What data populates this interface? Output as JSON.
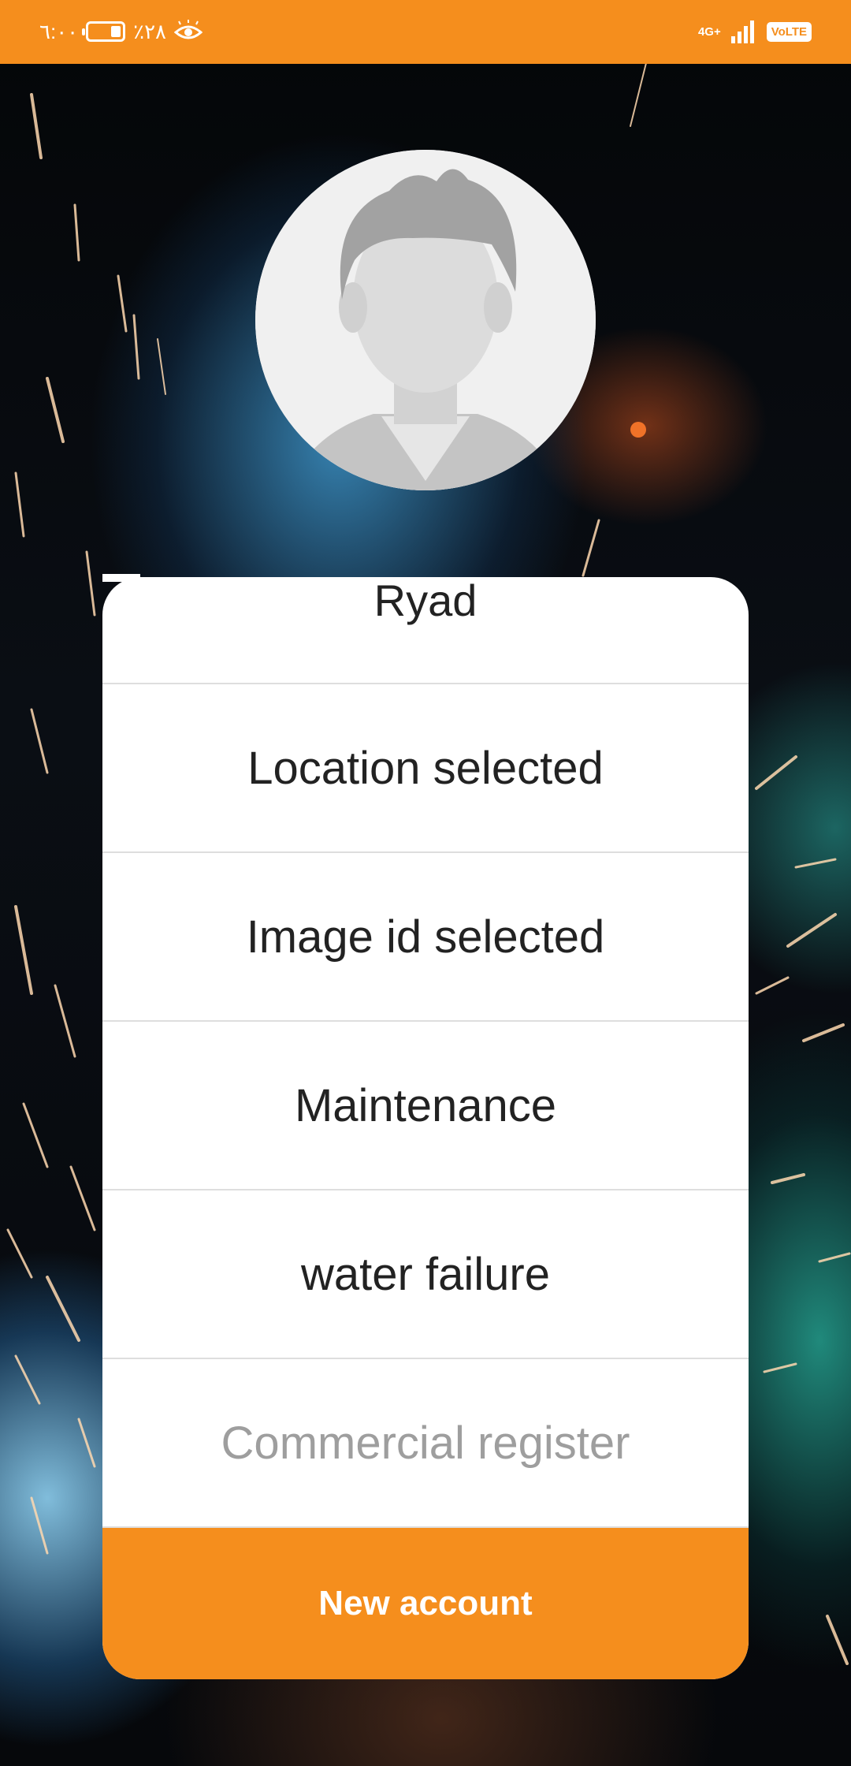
{
  "status_bar": {
    "time": "٦:٠٠",
    "battery_percent": "٪٢٨",
    "network_type": "4G+",
    "volte_label": "VoLTE",
    "background_color": "#f58e1d"
  },
  "profile": {
    "avatar_icon": "default-male-avatar-icon",
    "name": "Ryad"
  },
  "form": {
    "fields": [
      {
        "value": "Location selected",
        "is_placeholder": false
      },
      {
        "value": "Image id selected",
        "is_placeholder": false
      },
      {
        "value": "Maintenance",
        "is_placeholder": false
      },
      {
        "value": "water failure",
        "is_placeholder": false
      },
      {
        "value": "Commercial register",
        "is_placeholder": true
      }
    ],
    "submit_label": "New account",
    "accent_color": "#f58e1d"
  }
}
